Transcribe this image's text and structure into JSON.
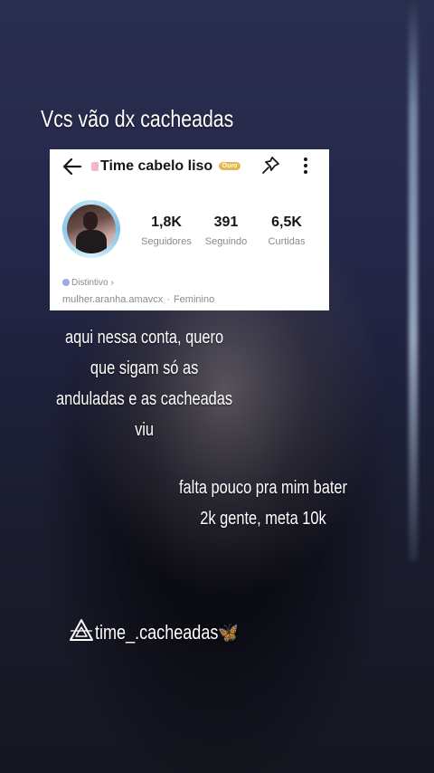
{
  "overlay": {
    "title": "Vcs vão dx cacheadas",
    "caption_1": [
      "aqui nessa conta, quero",
      "que sigam só as",
      "anduladas e as cacheadas",
      "viu"
    ],
    "caption_2": [
      "falta pouco pra mim bater",
      "2k gente, meta 10k"
    ],
    "handle": "time_.cacheadas🦋"
  },
  "profile_card": {
    "title": "Time cabelo liso",
    "badge_text": "Ouro",
    "back_icon": "arrow-left-icon",
    "pin_icon": "pin-icon",
    "more_icon": "more-vertical-icon",
    "stats": [
      {
        "value": "1,8K",
        "label": "Seguidores"
      },
      {
        "value": "391",
        "label": "Seguindo"
      },
      {
        "value": "6,5K",
        "label": "Curtidas"
      }
    ],
    "distintivo": "Distintivo ›",
    "username": "mulher.aranha.amavcx",
    "gender": "Feminino"
  },
  "colors": {
    "card_bg": "#ffffff",
    "text_dark": "#161616",
    "text_muted": "#8a8a8a",
    "badge_gold": "#e8b64a",
    "avatar_ring": "#7fc0e3"
  }
}
